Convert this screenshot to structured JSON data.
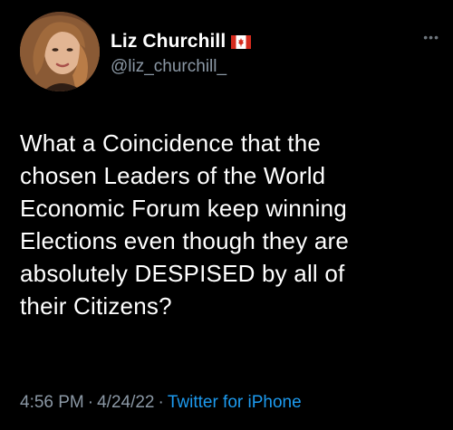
{
  "tweet": {
    "display_name": "Liz Churchill",
    "handle": "@liz_churchill_",
    "more_icon": "ellipsis-icon",
    "flag_icon": "canada-flag-icon",
    "text": "What a Coincidence that the\nchosen Leaders of the World\nEconomic Forum keep winning\nElections even though they are\nabsolutely DESPISED by all of\ntheir Citizens?",
    "time": "4:56 PM",
    "date": "4/24/22",
    "separator": "·",
    "source": "Twitter for iPhone"
  },
  "colors": {
    "background": "#000000",
    "name": "#ffffff",
    "secondary": "#8b98a5",
    "link": "#1d9bf0",
    "flag_red": "#d52b1e"
  }
}
